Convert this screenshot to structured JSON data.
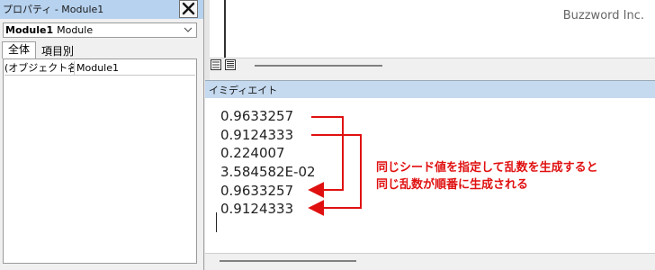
{
  "properties_pane": {
    "title": "プロパティ - Module1",
    "close_label": "✕",
    "object_selector": {
      "name": "Module1",
      "type": "Module"
    },
    "tabs": [
      "全体",
      "項目別"
    ],
    "property_rows": [
      {
        "name": "(オブジェクト名)",
        "value": "Module1"
      }
    ]
  },
  "code_window": {
    "view_icons": "☰☰"
  },
  "brand": "Buzzword Inc.",
  "immediate_window": {
    "title": "イミディエイト",
    "lines": [
      "0.9633257",
      "0.9124333",
      "0.224007",
      "3.584582E-02",
      "0.9633257",
      "0.9124333"
    ]
  },
  "annotation": {
    "lines": [
      "同じシード値を指定して乱数を生成すると",
      "同じ乱数が順番に生成される"
    ],
    "color": "#e01010"
  }
}
